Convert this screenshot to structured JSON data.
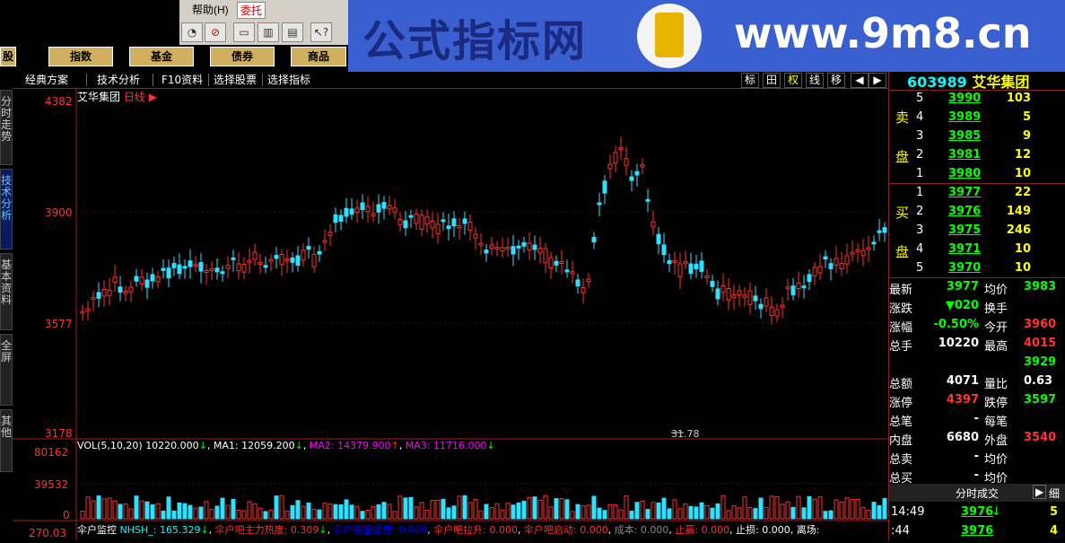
{
  "menu": {
    "help": "帮助(H)",
    "delegate": "委托"
  },
  "categories": [
    "股",
    "指数",
    "基金",
    "债券",
    "商品"
  ],
  "tabs": [
    "经典方案",
    "技术分析",
    "F10资料",
    "选择股票",
    "选择指标"
  ],
  "tab_buttons": [
    "标",
    "田",
    "权",
    "线",
    "移"
  ],
  "left_tabs": [
    "分时走势",
    "技术分析",
    "基本资料",
    "全屏",
    "其他"
  ],
  "watermark": {
    "title": "公式指标网",
    "url": "www.9m8.cn"
  },
  "chart": {
    "stock_name": "艾华集团",
    "period": "日线",
    "price_ticks": [
      "4382",
      "3900",
      "3577",
      "3178"
    ],
    "low_label": "31.78",
    "vol_ticks": [
      "80162",
      "39532",
      "0"
    ],
    "bottom_tick": "270.03",
    "vol_line": {
      "title": "VOL(5,10,20)",
      "value": "10220.000",
      "ma1_label": "MA1:",
      "ma1": "12059.200",
      "ma2_label": "MA2:",
      "ma2": "14379.900",
      "ma3_label": "MA3:",
      "ma3": "11716.000"
    },
    "indicator_line": {
      "name": "伞户监控",
      "nhsh": "NHSH_: 165.329",
      "t1": "伞户吧主力热度: 0.309",
      "t2": "伞户吧量能度: 0.000",
      "t3": "伞户吧拉升: 0.000",
      "t4": "伞户吧启动: 0.000",
      "t5": "成本: 0.000",
      "t6": "止赢: 0.000",
      "t7": "止损: 0.000",
      "t8": "离场:"
    }
  },
  "quote": {
    "code": "603989",
    "name": "艾华集团",
    "sell_label": [
      "卖",
      "盘"
    ],
    "buy_label": [
      "买",
      "盘"
    ],
    "sell": [
      {
        "lvl": "5",
        "price": "3990",
        "vol": "103"
      },
      {
        "lvl": "4",
        "price": "3989",
        "vol": "5"
      },
      {
        "lvl": "3",
        "price": "3985",
        "vol": "9"
      },
      {
        "lvl": "2",
        "price": "3981",
        "vol": "12"
      },
      {
        "lvl": "1",
        "price": "3980",
        "vol": "10"
      }
    ],
    "buy": [
      {
        "lvl": "1",
        "price": "3977",
        "vol": "22"
      },
      {
        "lvl": "2",
        "price": "3976",
        "vol": "149"
      },
      {
        "lvl": "3",
        "price": "3975",
        "vol": "246"
      },
      {
        "lvl": "4",
        "price": "3971",
        "vol": "10"
      },
      {
        "lvl": "5",
        "price": "3970",
        "vol": "10"
      }
    ],
    "stats": [
      {
        "k1": "最新",
        "v1": "3977",
        "k2": "均价",
        "v2": "3983"
      },
      {
        "k1": "涨跌",
        "v1": "▼020",
        "k2": "换手",
        "v2": ""
      },
      {
        "k1": "涨幅",
        "v1": "-0.50%",
        "k2": "今开",
        "v2": "3960"
      },
      {
        "k1": "总手",
        "v1": "10220",
        "k2": "最高",
        "v2": "4015"
      },
      {
        "k1": "",
        "v1": "",
        "k2": "",
        "v2": "3929"
      },
      {
        "k1": "总额",
        "v1": "4071",
        "k2": "量比",
        "v2": "0.63"
      },
      {
        "k1": "涨停",
        "v1": "4397",
        "k2": "跌停",
        "v2": "3597"
      },
      {
        "k1": "总笔",
        "v1": "-",
        "k2": "每笔",
        "v2": ""
      },
      {
        "k1": "内盘",
        "v1": "6680",
        "k2": "外盘",
        "v2": "3540"
      },
      {
        "k1": "总卖",
        "v1": "-",
        "k2": "均价",
        "v2": ""
      },
      {
        "k1": "总买",
        "v1": "-",
        "k2": "均价",
        "v2": ""
      }
    ],
    "ticks_header": "分时成交",
    "ticks_btn1": "▶",
    "ticks_btn2": "细",
    "ticks": [
      {
        "time": "14:49",
        "price": "3976",
        "arrow": "↓",
        "vol": "5"
      },
      {
        "time": ":44",
        "price": "3976",
        "arrow": "",
        "vol": "4"
      }
    ]
  }
}
